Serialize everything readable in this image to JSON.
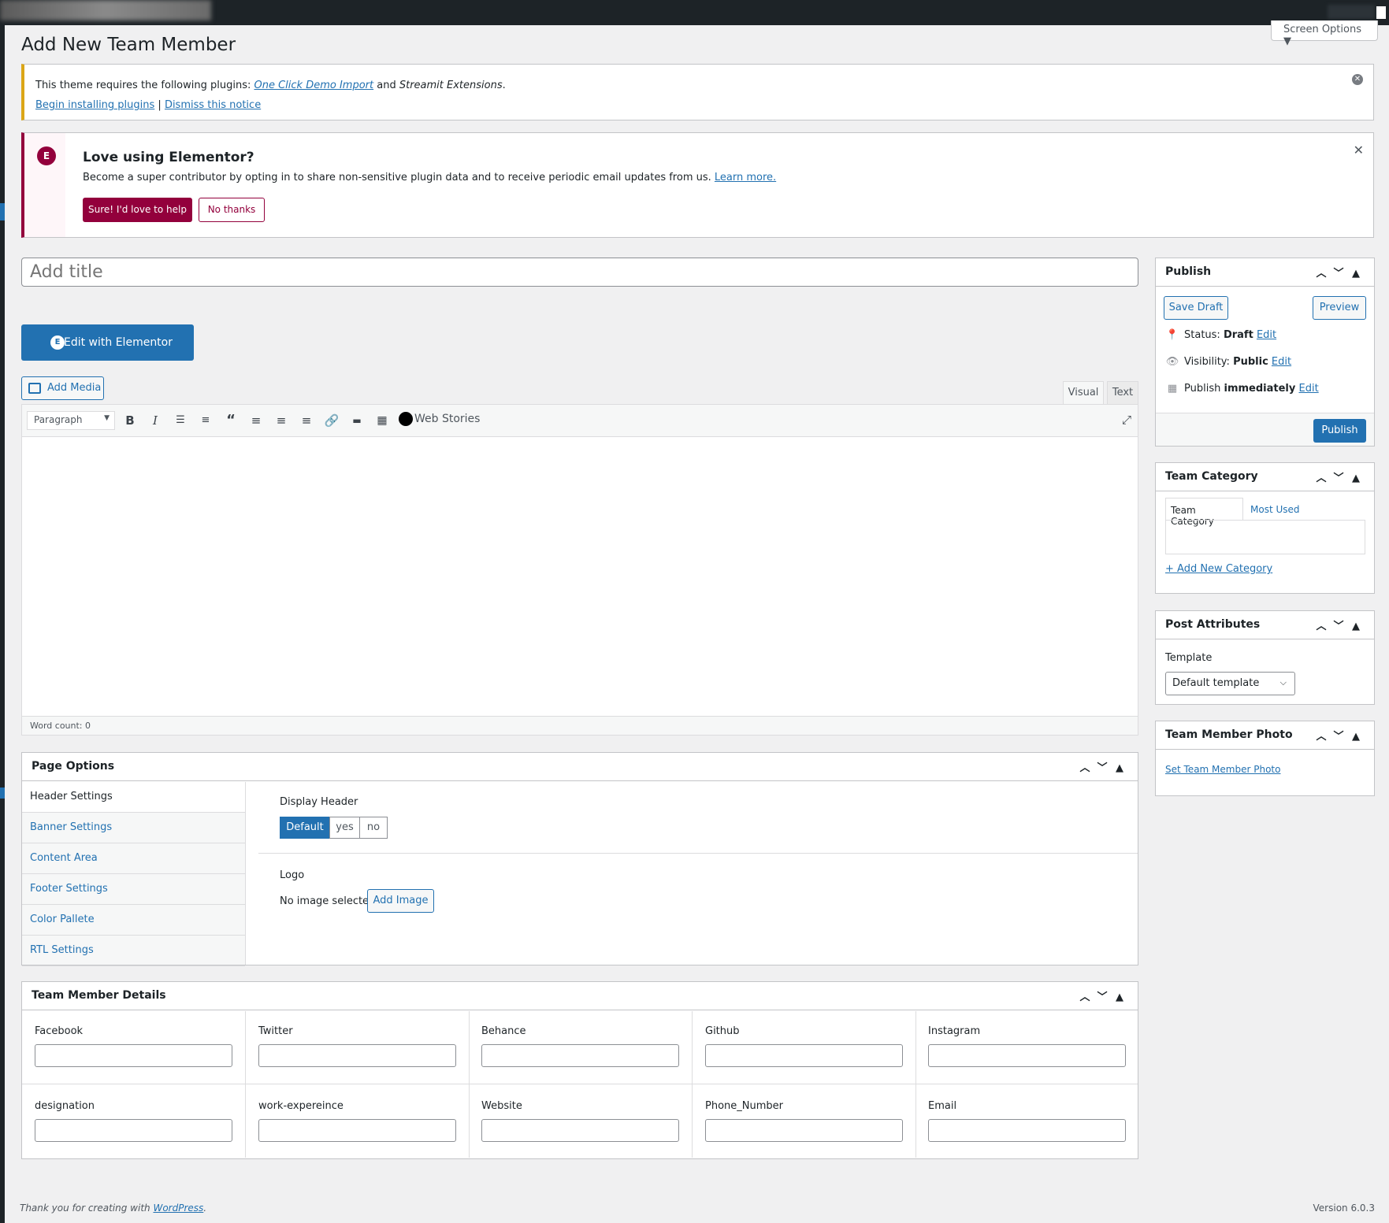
{
  "screen_options": "Screen Options ▼",
  "page_title": "Add New Team Member",
  "plugin_notice": {
    "prefix": "This theme requires the following plugins: ",
    "plugin1": "One Click Demo Import",
    "and": " and ",
    "plugin2": "Streamit Extensions",
    "suffix": ".",
    "begin_link": "Begin installing plugins",
    "sep": " | ",
    "dismiss_link": "Dismiss this notice"
  },
  "elementor_notice": {
    "title": "Love using Elementor?",
    "desc": "Become a super contributor by opting in to share non-sensitive plugin data and to receive periodic email updates from us. ",
    "learn_more": "Learn more.",
    "sure_btn": "Sure! I'd love to help",
    "no_btn": "No thanks"
  },
  "title_placeholder": "Add title",
  "edit_elementor": "Edit with Elementor",
  "add_media": "Add Media",
  "editor": {
    "tab_visual": "Visual",
    "tab_text": "Text",
    "paragraph": "Paragraph",
    "web_stories": "Web Stories",
    "word_count": "Word count: 0"
  },
  "page_options": {
    "title": "Page Options",
    "nav": [
      "Header Settings",
      "Banner Settings",
      "Content Area",
      "Footer Settings",
      "Color Pallete",
      "RTL Settings"
    ],
    "display_header": "Display Header",
    "seg": [
      "Default",
      "yes",
      "no"
    ],
    "logo": "Logo",
    "no_image": "No image selected",
    "add_image": "Add Image"
  },
  "team_details": {
    "title": "Team Member Details",
    "fields": [
      "Facebook",
      "Twitter",
      "Behance",
      "Github",
      "Instagram",
      "designation",
      "work-expereince",
      "Website",
      "Phone_Number",
      "Email"
    ]
  },
  "publish": {
    "title": "Publish",
    "save_draft": "Save Draft",
    "preview": "Preview",
    "status_label": "Status: ",
    "status_value": "Draft",
    "visibility_label": "Visibility: ",
    "visibility_value": "Public",
    "publish_label": "Publish ",
    "publish_value": "immediately",
    "edit": "Edit",
    "publish_btn": "Publish"
  },
  "team_category": {
    "title": "Team Category",
    "tab1": "Team Category",
    "tab2": "Most Used",
    "add_new": "+ Add New Category"
  },
  "post_attributes": {
    "title": "Post Attributes",
    "template_label": "Template",
    "template_value": "Default template"
  },
  "team_photo": {
    "title": "Team Member Photo",
    "link": "Set Team Member Photo"
  },
  "footer": {
    "left_prefix": "Thank you for creating with ",
    "left_link": "WordPress",
    "left_suffix": ".",
    "version": "Version 6.0.3"
  },
  "colors": {
    "accent": "#2271b1",
    "elementor": "#93003c",
    "warning": "#dba617"
  }
}
